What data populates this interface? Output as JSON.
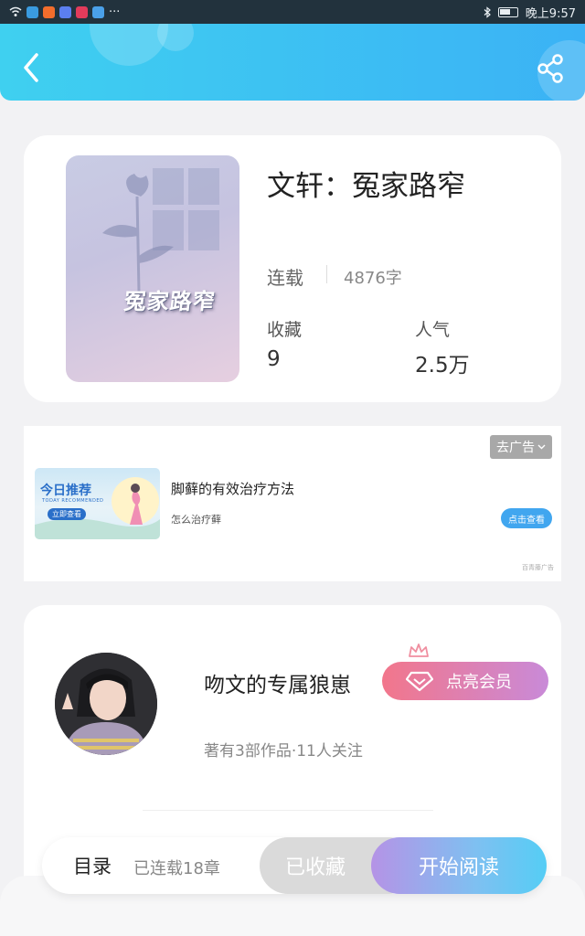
{
  "status_bar": {
    "time": "晚上9:57",
    "more": "···"
  },
  "book": {
    "title": "文轩：冤家路窄",
    "cover_title": "冤家路窄",
    "status": "连载",
    "word_count": "4876字",
    "favorites_label": "收藏",
    "favorites_value": "9",
    "popularity_label": "人气",
    "popularity_value": "2.5万"
  },
  "ad": {
    "close_label": "去广告",
    "image_title": "今日推荐",
    "image_subtitle": "TODAY RECOMMENDED",
    "image_button": "立即查看",
    "title": "脚藓的有效治疗方法",
    "description": "怎么治疗藓",
    "cta": "点击查看",
    "source": "百青藤广告"
  },
  "author": {
    "name": "吻文的专属狼崽",
    "vip_label": "点亮会员",
    "meta": "著有3部作品·11人关注"
  },
  "bottom_bar": {
    "toc_label": "目录",
    "chapter_count": "已连载18章",
    "collected_label": "已收藏",
    "read_label": "开始阅读"
  },
  "colors": {
    "header_start": "#3fd0f0",
    "header_end": "#3bb2f5",
    "vip_start": "#f2768b",
    "vip_end": "#c98ad8",
    "read_start": "#b593e6",
    "read_end": "#55cdf5"
  }
}
